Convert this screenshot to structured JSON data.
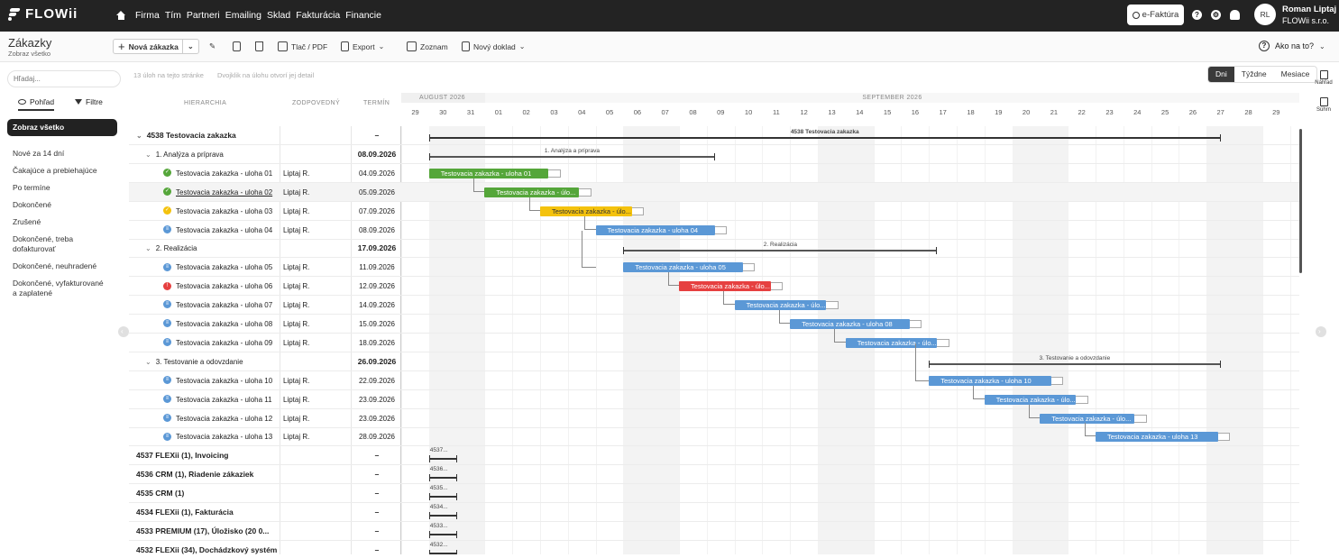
{
  "app": {
    "logo": "FLOWii",
    "nav": [
      "Firma",
      "Tím",
      "Partneri",
      "Emailing",
      "Sklad",
      "Fakturácia",
      "Financie"
    ],
    "efaktura": "e-Faktúra",
    "user_initials": "RL",
    "user_name": "Roman Liptaj",
    "user_company": "FLOWii s.r.o."
  },
  "page": {
    "title": "Zákazky",
    "subtitle": "Zobraz všetko"
  },
  "toolbar": {
    "new": "Nová zákazka",
    "print": "Tlač / PDF",
    "export": "Export",
    "list": "Zoznam",
    "newdoc": "Nový doklad",
    "help": "Ako na to?"
  },
  "search": {
    "placeholder": "Hľadaj..."
  },
  "hints": {
    "count": "13 úloh na tejto stránke",
    "dbl": "Dvojklik na úlohu otvorí jej detail"
  },
  "panel_tabs": {
    "view": "Pohľad",
    "filter": "Filtre"
  },
  "sidebar": {
    "items": [
      "Zobraz všetko",
      "Nové za 14 dní",
      "Čakajúce a prebiehajúce",
      "Po termíne",
      "Dokončené",
      "Zrušené",
      "Dokončené, treba dofakturovať",
      "Dokončené, neuhradené",
      "Dokončené, vyfakturované a zaplatené"
    ]
  },
  "view_switch": [
    "Dni",
    "Týždne",
    "Mesiace"
  ],
  "right_tools": [
    "Náhľad",
    "Súhrn"
  ],
  "grid": {
    "col_hier": "HIERARCHIA",
    "col_resp": "ZODPOVEDNÝ",
    "col_term": "TERMÍN",
    "month1": "AUGUST 2026",
    "month2": "SEPTEMBER 2026",
    "days": [
      "29",
      "30",
      "31",
      "01",
      "02",
      "03",
      "04",
      "05",
      "06",
      "07",
      "08",
      "09",
      "10",
      "11",
      "12",
      "13",
      "14",
      "15",
      "16",
      "17",
      "18",
      "19",
      "20",
      "21",
      "22",
      "23",
      "24",
      "25",
      "26",
      "27",
      "28",
      "29"
    ]
  },
  "colors": {
    "green": "#55a63a",
    "yellow": "#f4c20d",
    "blue": "#5b98d6",
    "red": "#e64040"
  },
  "rows": [
    {
      "name": "4538 Testovacia zakazka",
      "resp": "",
      "date": "–",
      "type": "project"
    },
    {
      "name": "1. Analýza a príprava",
      "resp": "",
      "date": "08.09.2026",
      "type": "phase"
    },
    {
      "name": "Testovacia zakazka - uloha 01",
      "resp": "Liptaj R.",
      "date": "04.09.2026",
      "type": "task",
      "status": "green",
      "bar": "Testovacia zakazka - uloha 01"
    },
    {
      "name": "Testovacia zakazka - uloha 02",
      "resp": "Liptaj R.",
      "date": "05.09.2026",
      "type": "task",
      "status": "green",
      "bar": "Testovacia zakazka - úlo...",
      "hl": true
    },
    {
      "name": "Testovacia zakazka - uloha 03",
      "resp": "Liptaj R.",
      "date": "07.09.2026",
      "type": "task",
      "status": "yellow",
      "bar": "Testovacia zakazka - úlo..."
    },
    {
      "name": "Testovacia zakazka - uloha 04",
      "resp": "Liptaj R.",
      "date": "08.09.2026",
      "type": "task",
      "status": "blue",
      "bar": "Testovacia zakazka - uloha 04"
    },
    {
      "name": "2. Realizácia",
      "resp": "",
      "date": "17.09.2026",
      "type": "phase"
    },
    {
      "name": "Testovacia zakazka - uloha 05",
      "resp": "Liptaj R.",
      "date": "11.09.2026",
      "type": "task",
      "status": "blue",
      "bar": "Testovacia zakazka - uloha 05"
    },
    {
      "name": "Testovacia zakazka - uloha 06",
      "resp": "Liptaj R.",
      "date": "12.09.2026",
      "type": "task",
      "status": "red",
      "bar": "Testovacia zakazka - úlo..."
    },
    {
      "name": "Testovacia zakazka - uloha 07",
      "resp": "Liptaj R.",
      "date": "14.09.2026",
      "type": "task",
      "status": "blue",
      "bar": "Testovacia zakazka - úlo..."
    },
    {
      "name": "Testovacia zakazka - uloha 08",
      "resp": "Liptaj R.",
      "date": "15.09.2026",
      "type": "task",
      "status": "blue",
      "bar": "Testovacia zakazka - uloha 08"
    },
    {
      "name": "Testovacia zakazka - uloha 09",
      "resp": "Liptaj R.",
      "date": "18.09.2026",
      "type": "task",
      "status": "blue",
      "bar": "Testovacia zakazka - úlo..."
    },
    {
      "name": "3. Testovanie a odovzdanie",
      "resp": "",
      "date": "26.09.2026",
      "type": "phase"
    },
    {
      "name": "Testovacia zakazka - uloha 10",
      "resp": "Liptaj R.",
      "date": "22.09.2026",
      "type": "task",
      "status": "blue",
      "bar": "Testovacia zakazka - uloha 10"
    },
    {
      "name": "Testovacia zakazka - uloha 11",
      "resp": "Liptaj R.",
      "date": "23.09.2026",
      "type": "task",
      "status": "blue",
      "bar": "Testovacia zakazka - úlo..."
    },
    {
      "name": "Testovacia zakazka - uloha 12",
      "resp": "Liptaj R.",
      "date": "23.09.2026",
      "type": "task",
      "status": "blue",
      "bar": "Testovacia zakazka - úlo..."
    },
    {
      "name": "Testovacia zakazka - uloha 13",
      "resp": "Liptaj R.",
      "date": "28.09.2026",
      "type": "task",
      "status": "blue",
      "bar": "Testovacia zakazka - uloha 13"
    },
    {
      "name": "4537 FLEXii (1), Invoicing",
      "resp": "",
      "date": "–",
      "type": "other",
      "bar": "4537..."
    },
    {
      "name": "4536 CRM (1), Riadenie zákaziek",
      "resp": "",
      "date": "–",
      "type": "other",
      "bar": "4536..."
    },
    {
      "name": "4535 CRM (1)",
      "resp": "",
      "date": "–",
      "type": "other",
      "bar": "4535..."
    },
    {
      "name": "4534 FLEXii (1), Fakturácia",
      "resp": "",
      "date": "–",
      "type": "other",
      "bar": "4534..."
    },
    {
      "name": "4533 PREMIUM (17), Úložisko (20 0...",
      "resp": "",
      "date": "–",
      "type": "other",
      "bar": "4533..."
    },
    {
      "name": "4532 FLEXii (34), Dochádzkový systém",
      "resp": "",
      "date": "–",
      "type": "other",
      "bar": "4532..."
    }
  ],
  "gantt_labels": {
    "project": "4538 Testovacia zakazka",
    "phase1": "1. Analýza a príprava",
    "phase2": "2. Realizácia",
    "phase3": "3. Testovanie a odovzdanie"
  }
}
